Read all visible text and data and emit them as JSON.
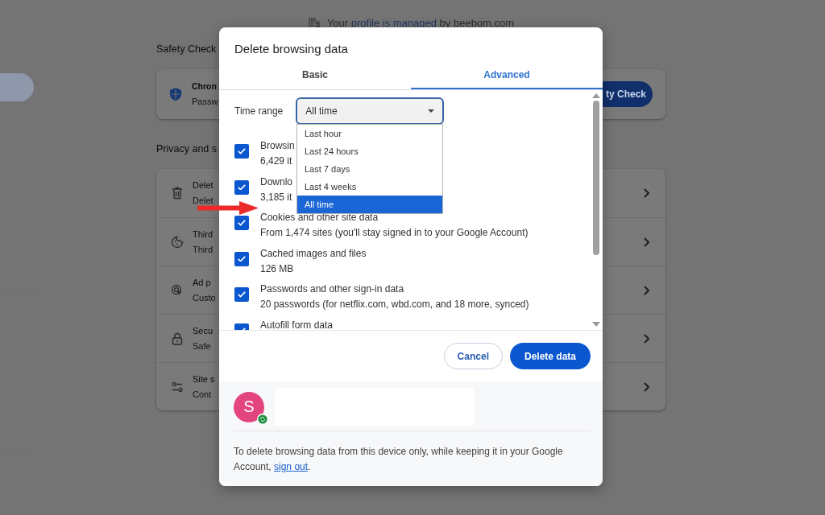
{
  "managed_notice": {
    "prefix": "Your",
    "link": "profile is managed",
    "suffix": "by beebom.com"
  },
  "safety_check": {
    "title": "Safety Check",
    "card_title": "Chron",
    "card_subtitle": "Passw",
    "button": "ty Check"
  },
  "privacy": {
    "title": "Privacy and s",
    "rows": [
      {
        "title": "Delet",
        "subtitle": "Delet"
      },
      {
        "title": "Third",
        "subtitle": "Third"
      },
      {
        "title": "Ad p",
        "subtitle": "Custo"
      },
      {
        "title": "Secu",
        "subtitle": "Safe"
      },
      {
        "title": "Site s",
        "subtitle": "Cont"
      }
    ]
  },
  "dialog": {
    "title": "Delete browsing data",
    "tabs": [
      {
        "label": "Basic",
        "selected": false
      },
      {
        "label": "Advanced",
        "selected": true
      }
    ],
    "time_range": {
      "label": "Time range",
      "value": "All time",
      "expanded": true,
      "options": [
        {
          "label": "Last hour",
          "selected": false
        },
        {
          "label": "Last 24 hours",
          "selected": false
        },
        {
          "label": "Last 7 days",
          "selected": false
        },
        {
          "label": "Last 4 weeks",
          "selected": false
        },
        {
          "label": "All time",
          "selected": true
        }
      ]
    },
    "items": [
      {
        "title": "Browsin",
        "detail": "6,429 it",
        "checked": true
      },
      {
        "title": "Downlo",
        "detail": "3,185 it",
        "checked": true
      },
      {
        "title": "Cookies and other site data",
        "detail": "From 1,474 sites (you'll stay signed in to your Google Account)",
        "checked": true
      },
      {
        "title": "Cached images and files",
        "detail": "126 MB",
        "checked": true
      },
      {
        "title": "Passwords and other sign-in data",
        "detail": "20 passwords (for netflix.com, wbd.com, and 18 more, synced)",
        "checked": true
      },
      {
        "title": "Autofill form data",
        "checked": true
      }
    ],
    "cancel_button": "Cancel",
    "delete_button": "Delete data",
    "account": {
      "avatar_letter": "S"
    },
    "note": {
      "text": "To delete browsing data from this device only, while keeping it in your Google Account,",
      "link": "sign out",
      "end": "."
    }
  }
}
